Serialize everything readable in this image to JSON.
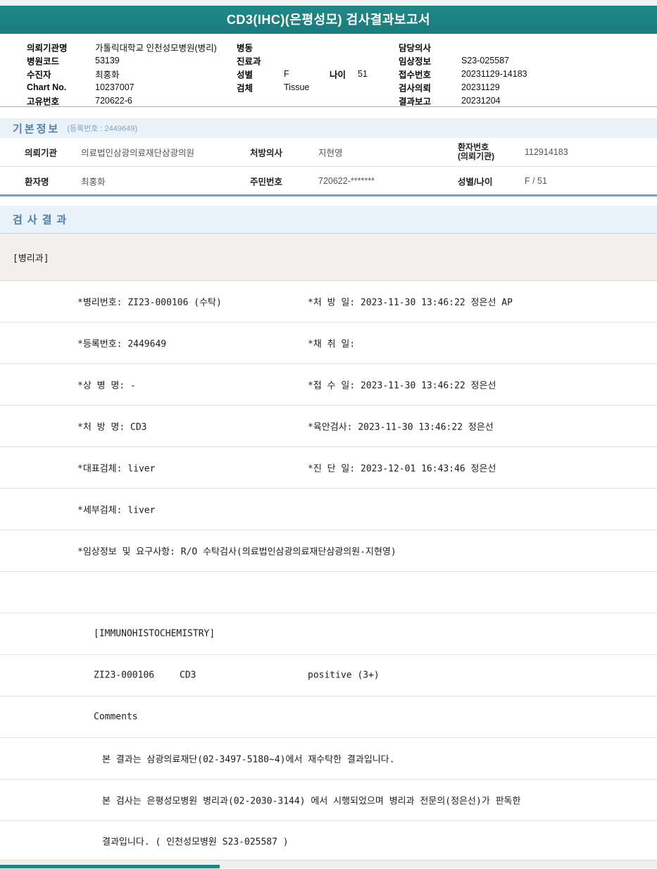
{
  "title": "CD3(IHC)(은평성모) 검사결과보고서",
  "patient_header": {
    "rows": [
      {
        "l1": "의뢰기관명",
        "v1": "가톨릭대학교 인천성모병원(병리)",
        "l2": "병동",
        "v2": "",
        "l2b": "",
        "v2b": "",
        "l3": "담당의사",
        "v3": ""
      },
      {
        "l1": "병원코드",
        "v1": "53139",
        "l2": "진료과",
        "v2": "",
        "l2b": "",
        "v2b": "",
        "l3": "임상정보",
        "v3": "S23-025587"
      },
      {
        "l1": "수진자",
        "v1": "최홍화",
        "l2": "성별",
        "v2": "F",
        "l2b": "나이",
        "v2b": "51",
        "l3": "접수번호",
        "v3": "20231129-14183"
      },
      {
        "l1": "Chart No.",
        "v1": "10237007",
        "l2": "검체",
        "v2": "Tissue",
        "l2b": "",
        "v2b": "",
        "l3": "검사의뢰",
        "v3": "20231129"
      },
      {
        "l1": "고유번호",
        "v1": "720622-6",
        "l2": "",
        "v2": "",
        "l2b": "",
        "v2b": "",
        "l3": "결과보고",
        "v3": "20231204"
      }
    ]
  },
  "basic_info": {
    "title": "기본정보",
    "subtitle": "(등록번호 : 2449649)",
    "row1": {
      "l1": "의뢰기관",
      "v1": "의료법인삼광의료재단삼광의원",
      "l2": "처방의사",
      "v2": "지현영",
      "l3a": "환자번호",
      "l3b": "(의뢰기관)",
      "v3": "112914183"
    },
    "row2": {
      "l1": "환자명",
      "v1": "최홍화",
      "l2": "주민번호",
      "v2": "720622-*******",
      "l3": "성별/나이",
      "v3": "F / 51"
    }
  },
  "results": {
    "title": "검사결과",
    "department": "[병리과]",
    "rows": [
      {
        "left": "*병리번호: ZI23-000106 (수탁)",
        "right": "*처 방 일: 2023-11-30 13:46:22  정은선 AP"
      },
      {
        "left": "*등록번호: 2449649",
        "right": "*채 취 일:"
      },
      {
        "left": "*상 병 명: -",
        "right": "*접 수 일: 2023-11-30 13:46:22  정은선"
      },
      {
        "left": "*처 방 명: CD3",
        "right": "*육안검사: 2023-11-30 13:46:22  정은선"
      },
      {
        "left": "*대표검체: liver",
        "right": "*진 단 일: 2023-12-01 16:43:46  정은선"
      },
      {
        "left": "*세부검체: liver",
        "right": ""
      },
      {
        "left": "*임상정보 및 요구사항: R/O 수탁검사(의료법인삼광의료재단삼광의원-지현영)",
        "right": ""
      },
      {
        "left": "",
        "right": ""
      },
      {
        "left": "[IMMUNOHISTOCHEMISTRY]",
        "right": ""
      },
      {
        "left": "ZI23-000106",
        "mid": "CD3",
        "right": "positive (3+)"
      },
      {
        "left": "Comments",
        "right": ""
      },
      {
        "left": "본 결과는 삼광의료재단(02-3497-5180~4)에서 재수탁한 결과입니다.",
        "right": ""
      },
      {
        "left": "본 검사는 은평성모병원 병리과(02-2030-3144) 에서 시행되었으며 병리과 전문의(정은선)가 판독한",
        "right": ""
      },
      {
        "left": "결과입니다. ( 인천성모병원 S23-025587 )",
        "right": ""
      }
    ]
  },
  "colors": {
    "accent_teal": "#1e8182",
    "section_band_bg": "#e9f2f9",
    "section_title_blue": "#4f7ca9",
    "table_bottom_border": "#7da0bf",
    "footer_bg": "#efefef"
  }
}
